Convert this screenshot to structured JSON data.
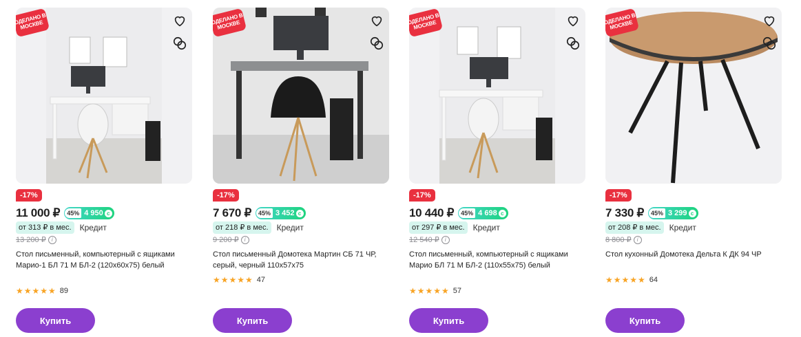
{
  "products": [
    {
      "badge": "ОДЕЛАНО В МОСКВЕ",
      "discount": "-17%",
      "price": "11 000 ₽",
      "bonus_percent": "45%",
      "bonus_amount": "4 950",
      "monthly": "от 313 ₽ в мес.",
      "credit_label": "Кредит",
      "old_price": "13 200 ₽",
      "title": "Стол письменный, компьютерный с ящиками Марио-1 БЛ 71 М БЛ-2 (120x60x75) белый",
      "rating": 5,
      "reviews": "89",
      "buy_label": "Купить"
    },
    {
      "badge": "ОДЕЛАНО В МОСКВЕ",
      "discount": "-17%",
      "price": "7 670 ₽",
      "bonus_percent": "45%",
      "bonus_amount": "3 452",
      "monthly": "от 218 ₽ в мес.",
      "credit_label": "Кредит",
      "old_price": "9 200 ₽",
      "title": "Стол письменный Домотека Мартин СБ 71 ЧР, серый, черный 110x57x75",
      "rating": 5,
      "reviews": "47",
      "buy_label": "Купить"
    },
    {
      "badge": "ОДЕЛАНО В МОСКВЕ",
      "discount": "-17%",
      "price": "10 440 ₽",
      "bonus_percent": "45%",
      "bonus_amount": "4 698",
      "monthly": "от 297 ₽ в мес.",
      "credit_label": "Кредит",
      "old_price": "12 540 ₽",
      "title": "Стол письменный, компьютерный с ящиками Марио БЛ 71 М БЛ-2 (110x55x75) белый",
      "rating": 5,
      "reviews": "57",
      "buy_label": "Купить"
    },
    {
      "badge": "ОДЕЛАНО В МОСКВЕ",
      "discount": "-17%",
      "price": "7 330 ₽",
      "bonus_percent": "45%",
      "bonus_amount": "3 299",
      "monthly": "от 208 ₽ в мес.",
      "credit_label": "Кредит",
      "old_price": "8 800 ₽",
      "title": "Стол кухонный Домотека Дельта К ДК 94 ЧР",
      "rating": 5,
      "reviews": "64",
      "buy_label": "Купить"
    }
  ],
  "icons": {
    "favorite": "heart-icon",
    "compare": "compare-icon",
    "info": "info-icon",
    "star": "star-icon"
  },
  "colors": {
    "accent": "#8b3fcf",
    "discount": "#e9303f",
    "bonus": "#1ed37e",
    "monthly_bg": "#d6f5ee",
    "star": "#f8a425"
  }
}
